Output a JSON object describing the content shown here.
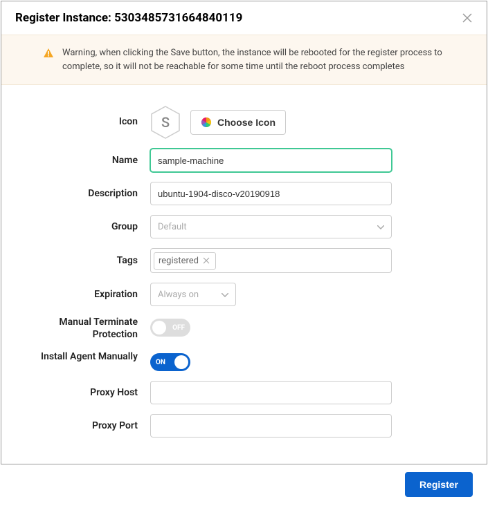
{
  "header": {
    "title": "Register Instance: 5303485731664840119"
  },
  "warning": {
    "text": "Warning, when clicking the Save button, the instance will be rebooted for the register process to complete, so it will not be reachable for some time until the reboot process completes"
  },
  "form": {
    "icon": {
      "label": "Icon",
      "letter": "S",
      "choose_label": "Choose Icon"
    },
    "name": {
      "label": "Name",
      "value": "sample-machine"
    },
    "description": {
      "label": "Description",
      "value": "ubuntu-1904-disco-v20190918"
    },
    "group": {
      "label": "Group",
      "selected": "Default"
    },
    "tags": {
      "label": "Tags",
      "items": [
        "registered"
      ]
    },
    "expiration": {
      "label": "Expiration",
      "selected": "Always on"
    },
    "manual_terminate": {
      "label": "Manual Terminate Protection",
      "value": false,
      "text": "OFF"
    },
    "install_agent": {
      "label": "Install Agent Manually",
      "value": true,
      "text": "ON"
    },
    "proxy_host": {
      "label": "Proxy Host",
      "value": ""
    },
    "proxy_port": {
      "label": "Proxy Port",
      "value": ""
    }
  },
  "footer": {
    "register_label": "Register"
  }
}
